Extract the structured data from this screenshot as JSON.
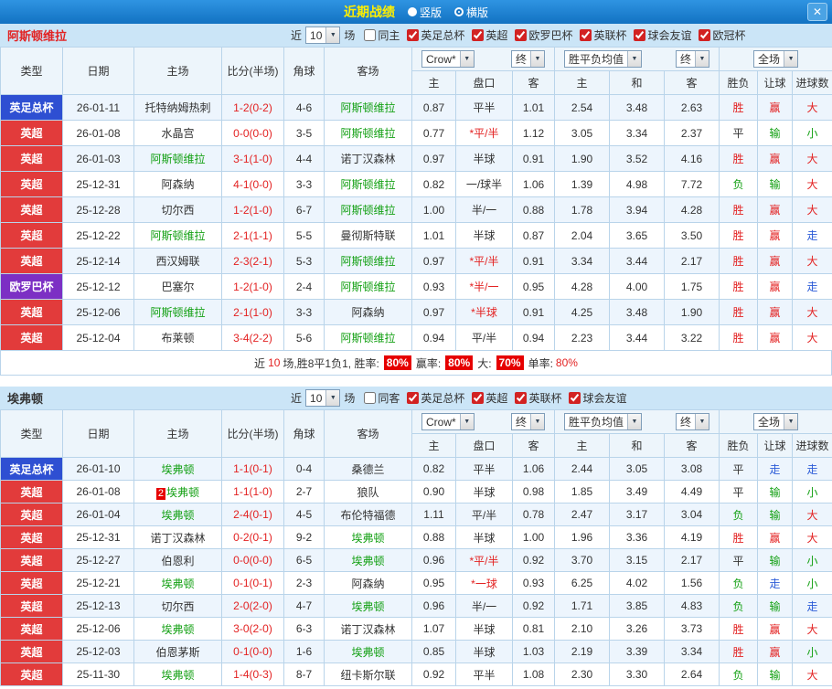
{
  "icons": {
    "chevron": "▼",
    "close": "✕"
  },
  "titlebar": {
    "title": "近期战绩",
    "radios": [
      {
        "label": "竖版",
        "selected": false
      },
      {
        "label": "横版",
        "selected": true
      }
    ]
  },
  "header_controls": {
    "bookmaker": "Crow*",
    "final_ah": "终",
    "wdl_avg": "胜平负均值",
    "final_eu": "终",
    "scope": "全场"
  },
  "columns": {
    "type": "类型",
    "date": "日期",
    "home": "主场",
    "score": "比分(半场)",
    "corner": "角球",
    "away": "客场",
    "ah_home": "主",
    "ah_line": "盘口",
    "ah_away": "客",
    "eu_home": "主",
    "eu_draw": "和",
    "eu_away": "客",
    "r_wdl": "胜负",
    "r_handicap": "让球",
    "r_goals": "进球数"
  },
  "sections": [
    {
      "team": "阿斯顿维拉",
      "filter": {
        "near": "近",
        "count": "10",
        "games": "场",
        "checks": [
          {
            "label": "同主",
            "checked": false
          },
          {
            "label": "英足总杯",
            "checked": true
          },
          {
            "label": "英超",
            "checked": true
          },
          {
            "label": "欧罗巴杯",
            "checked": true
          },
          {
            "label": "英联杯",
            "checked": true
          },
          {
            "label": "球会友谊",
            "checked": true
          },
          {
            "label": "欧冠杯",
            "checked": true
          }
        ]
      },
      "rows": [
        {
          "type": "英足总杯",
          "date": "26-01-11",
          "home": "托特纳姆热刺",
          "score": "1-2(0-2)",
          "corner": "4-6",
          "away": "阿斯顿维拉",
          "ah1": "0.87",
          "line": "平半",
          "ah2": "1.01",
          "eu1": "2.54",
          "eu2": "3.48",
          "eu3": "2.63",
          "r1": "胜",
          "r2": "赢",
          "r3": "大"
        },
        {
          "type": "英超",
          "date": "26-01-08",
          "home": "水晶宫",
          "score": "0-0(0-0)",
          "corner": "3-5",
          "away": "阿斯顿维拉",
          "ah1": "0.77",
          "line": "*平/半",
          "ah2": "1.12",
          "eu1": "3.05",
          "eu2": "3.34",
          "eu3": "2.37",
          "r1": "平",
          "r2": "输",
          "r3": "小"
        },
        {
          "type": "英超",
          "date": "26-01-03",
          "home": "阿斯顿维拉",
          "score": "3-1(1-0)",
          "corner": "4-4",
          "away": "诺丁汉森林",
          "ah1": "0.97",
          "line": "半球",
          "ah2": "0.91",
          "eu1": "1.90",
          "eu2": "3.52",
          "eu3": "4.16",
          "r1": "胜",
          "r2": "赢",
          "r3": "大"
        },
        {
          "type": "英超",
          "date": "25-12-31",
          "home": "阿森纳",
          "score": "4-1(0-0)",
          "corner": "3-3",
          "away": "阿斯顿维拉",
          "ah1": "0.82",
          "line": "一/球半",
          "ah2": "1.06",
          "eu1": "1.39",
          "eu2": "4.98",
          "eu3": "7.72",
          "r1": "负",
          "r2": "输",
          "r3": "大"
        },
        {
          "type": "英超",
          "date": "25-12-28",
          "home": "切尔西",
          "score": "1-2(1-0)",
          "corner": "6-7",
          "away": "阿斯顿维拉",
          "ah1": "1.00",
          "line": "半/一",
          "ah2": "0.88",
          "eu1": "1.78",
          "eu2": "3.94",
          "eu3": "4.28",
          "r1": "胜",
          "r2": "赢",
          "r3": "大"
        },
        {
          "type": "英超",
          "date": "25-12-22",
          "home": "阿斯顿维拉",
          "score": "2-1(1-1)",
          "corner": "5-5",
          "away": "曼彻斯特联",
          "ah1": "1.01",
          "line": "半球",
          "ah2": "0.87",
          "eu1": "2.04",
          "eu2": "3.65",
          "eu3": "3.50",
          "r1": "胜",
          "r2": "赢",
          "r3": "走"
        },
        {
          "type": "英超",
          "date": "25-12-14",
          "home": "西汉姆联",
          "score": "2-3(2-1)",
          "corner": "5-3",
          "away": "阿斯顿维拉",
          "ah1": "0.97",
          "line": "*平/半",
          "ah2": "0.91",
          "eu1": "3.34",
          "eu2": "3.44",
          "eu3": "2.17",
          "r1": "胜",
          "r2": "赢",
          "r3": "大"
        },
        {
          "type": "欧罗巴杯",
          "date": "25-12-12",
          "home": "巴塞尔",
          "score": "1-2(1-0)",
          "corner": "2-4",
          "away": "阿斯顿维拉",
          "ah1": "0.93",
          "line": "*半/一",
          "ah2": "0.95",
          "eu1": "4.28",
          "eu2": "4.00",
          "eu3": "1.75",
          "r1": "胜",
          "r2": "赢",
          "r3": "走"
        },
        {
          "type": "英超",
          "date": "25-12-06",
          "home": "阿斯顿维拉",
          "score": "2-1(1-0)",
          "corner": "3-3",
          "away": "阿森纳",
          "ah1": "0.97",
          "line": "*半球",
          "ah2": "0.91",
          "eu1": "4.25",
          "eu2": "3.48",
          "eu3": "1.90",
          "r1": "胜",
          "r2": "赢",
          "r3": "大"
        },
        {
          "type": "英超",
          "date": "25-12-04",
          "home": "布莱顿",
          "score": "3-4(2-2)",
          "corner": "5-6",
          "away": "阿斯顿维拉",
          "ah1": "0.94",
          "line": "平/半",
          "ah2": "0.94",
          "eu1": "2.23",
          "eu2": "3.44",
          "eu3": "3.22",
          "r1": "胜",
          "r2": "赢",
          "r3": "大"
        }
      ],
      "summary": {
        "p1": "近",
        "n1": "10",
        "p2": "场,胜8平1负1, 胜率:",
        "b1": "80%",
        "p3": "赢率:",
        "b2": "80%",
        "p4": "大:",
        "b3": "70%",
        "p5": "单率:",
        "n2": "80%"
      }
    },
    {
      "team": "埃弗顿",
      "filter": {
        "near": "近",
        "count": "10",
        "games": "场",
        "checks": [
          {
            "label": "同客",
            "checked": false
          },
          {
            "label": "英足总杯",
            "checked": true
          },
          {
            "label": "英超",
            "checked": true
          },
          {
            "label": "英联杯",
            "checked": true
          },
          {
            "label": "球会友谊",
            "checked": true
          }
        ]
      },
      "rows": [
        {
          "type": "英足总杯",
          "date": "26-01-10",
          "home": "埃弗顿",
          "score": "1-1(0-1)",
          "corner": "0-4",
          "away": "桑德兰",
          "ah1": "0.82",
          "line": "平半",
          "ah2": "1.06",
          "eu1": "2.44",
          "eu2": "3.05",
          "eu3": "3.08",
          "r1": "平",
          "r2": "走",
          "r3": "走"
        },
        {
          "type": "英超",
          "date": "26-01-08",
          "home": "埃弗顿",
          "home_badge": "2",
          "score": "1-1(1-0)",
          "corner": "2-7",
          "away": "狼队",
          "ah1": "0.90",
          "line": "半球",
          "ah2": "0.98",
          "eu1": "1.85",
          "eu2": "3.49",
          "eu3": "4.49",
          "r1": "平",
          "r2": "输",
          "r3": "小"
        },
        {
          "type": "英超",
          "date": "26-01-04",
          "home": "埃弗顿",
          "score": "2-4(0-1)",
          "corner": "4-5",
          "away": "布伦特福德",
          "ah1": "1.11",
          "line": "平/半",
          "ah2": "0.78",
          "eu1": "2.47",
          "eu2": "3.17",
          "eu3": "3.04",
          "r1": "负",
          "r2": "输",
          "r3": "大"
        },
        {
          "type": "英超",
          "date": "25-12-31",
          "home": "诺丁汉森林",
          "score": "0-2(0-1)",
          "corner": "9-2",
          "away": "埃弗顿",
          "ah1": "0.88",
          "line": "半球",
          "ah2": "1.00",
          "eu1": "1.96",
          "eu2": "3.36",
          "eu3": "4.19",
          "r1": "胜",
          "r2": "赢",
          "r3": "大"
        },
        {
          "type": "英超",
          "date": "25-12-27",
          "home": "伯恩利",
          "score": "0-0(0-0)",
          "corner": "6-5",
          "away": "埃弗顿",
          "ah1": "0.96",
          "line": "*平/半",
          "ah2": "0.92",
          "eu1": "3.70",
          "eu2": "3.15",
          "eu3": "2.17",
          "r1": "平",
          "r2": "输",
          "r3": "小"
        },
        {
          "type": "英超",
          "date": "25-12-21",
          "home": "埃弗顿",
          "score": "0-1(0-1)",
          "corner": "2-3",
          "away": "阿森纳",
          "ah1": "0.95",
          "line": "*一球",
          "ah2": "0.93",
          "eu1": "6.25",
          "eu2": "4.02",
          "eu3": "1.56",
          "r1": "负",
          "r2": "走",
          "r3": "小"
        },
        {
          "type": "英超",
          "date": "25-12-13",
          "home": "切尔西",
          "score": "2-0(2-0)",
          "corner": "4-7",
          "away": "埃弗顿",
          "ah1": "0.96",
          "line": "半/一",
          "ah2": "0.92",
          "eu1": "1.71",
          "eu2": "3.85",
          "eu3": "4.83",
          "r1": "负",
          "r2": "输",
          "r3": "走"
        },
        {
          "type": "英超",
          "date": "25-12-06",
          "home": "埃弗顿",
          "score": "3-0(2-0)",
          "corner": "6-3",
          "away": "诺丁汉森林",
          "ah1": "1.07",
          "line": "半球",
          "ah2": "0.81",
          "eu1": "2.10",
          "eu2": "3.26",
          "eu3": "3.73",
          "r1": "胜",
          "r2": "赢",
          "r3": "大"
        },
        {
          "type": "英超",
          "date": "25-12-03",
          "home": "伯恩茅斯",
          "score": "0-1(0-0)",
          "corner": "1-6",
          "away": "埃弗顿",
          "ah1": "0.85",
          "line": "半球",
          "ah2": "1.03",
          "eu1": "2.19",
          "eu2": "3.39",
          "eu3": "3.34",
          "r1": "胜",
          "r2": "赢",
          "r3": "小"
        },
        {
          "type": "英超",
          "date": "25-11-30",
          "home": "埃弗顿",
          "score": "1-4(0-3)",
          "corner": "8-7",
          "away": "纽卡斯尔联",
          "ah1": "0.92",
          "line": "平半",
          "ah2": "1.08",
          "eu1": "2.30",
          "eu2": "3.30",
          "eu3": "2.64",
          "r1": "负",
          "r2": "输",
          "r3": "大"
        }
      ]
    }
  ]
}
